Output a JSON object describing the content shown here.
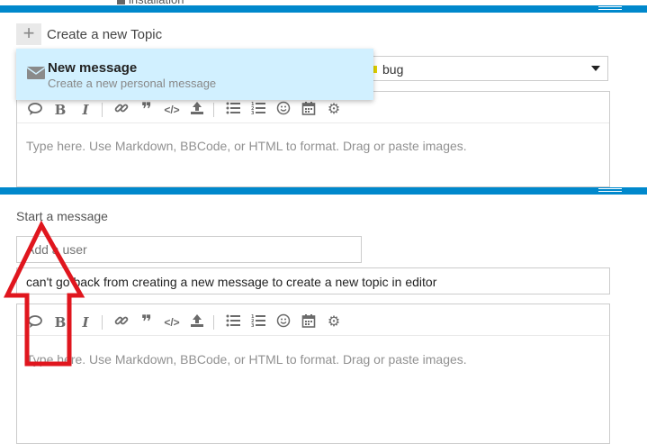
{
  "top_cut_text": "installation",
  "composer_topic": {
    "header_title": "Create a new Topic",
    "plus_icon": "+",
    "dropdown": {
      "icon": "envelope-icon",
      "title": "New message",
      "description": "Create a new personal message"
    },
    "category": {
      "label": "bug",
      "color": "#e0d000"
    },
    "editor_placeholder": "Type here. Use Markdown, BBCode, or HTML to format. Drag or paste images."
  },
  "composer_message": {
    "header_title": "Start a message",
    "add_user_placeholder": "Add a user",
    "title_value": "can't go back from creating a new message to create a new topic in editor",
    "editor_placeholder": "Type here. Use Markdown, BBCode, or HTML to format. Drag or paste images."
  },
  "toolbar": {
    "buttons": [
      "quote-icon",
      "bold-icon",
      "italic-icon",
      "link-icon",
      "blockquote-icon",
      "code-icon",
      "upload-icon",
      "bullet-list-icon",
      "numbered-list-icon",
      "emoji-icon",
      "calendar-icon",
      "gear-icon"
    ]
  },
  "colors": {
    "brand_blue": "#0088cc",
    "dropdown_bg": "#d1f0ff",
    "annotation_red": "#e0161e"
  }
}
